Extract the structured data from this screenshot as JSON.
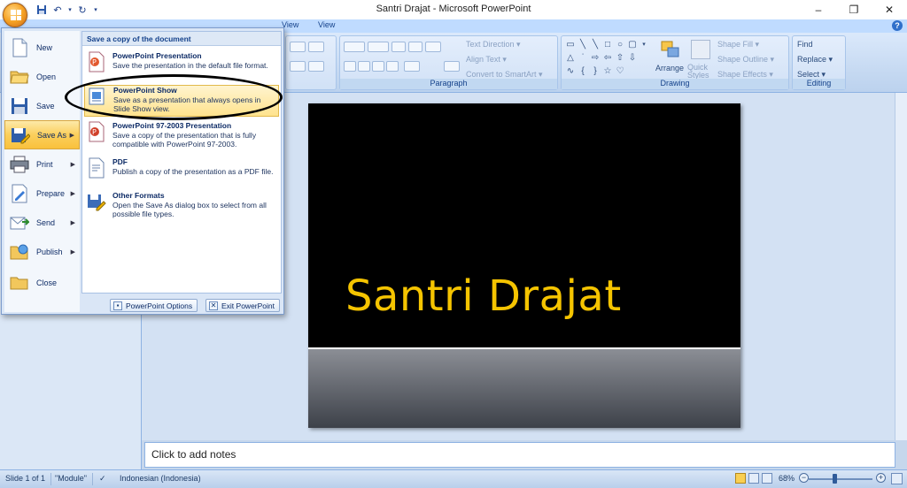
{
  "window": {
    "title": "Santri Drajat - Microsoft PowerPoint",
    "minimize_icon": "–",
    "restore_icon": "❐",
    "close_icon": "✕"
  },
  "quick_access": {
    "save_icon": "save-icon",
    "undo_icon": "undo-icon",
    "redo_icon": "repeat-icon"
  },
  "tabs": [
    {
      "label": "View"
    },
    {
      "label": "View"
    }
  ],
  "help": "?",
  "ribbon": {
    "paragraph_group_label": "Paragraph",
    "drawing_group_label": "Drawing",
    "editing_group_label": "Editing",
    "text_direction": "Text Direction ▾",
    "align_text": "Align Text ▾",
    "convert_smartart": "Convert to SmartArt ▾",
    "arrange": "Arrange",
    "quick_styles": "Quick Styles ▾",
    "shape_fill": "Shape Fill ▾",
    "shape_outline": "Shape Outline ▾",
    "shape_effects": "Shape Effects ▾",
    "find": "Find",
    "replace": "Replace ▾",
    "select": "Select ▾"
  },
  "office_menu": {
    "left_items": [
      {
        "label": "New",
        "icon": "new-document-icon",
        "has_submenu": false
      },
      {
        "label": "Open",
        "icon": "open-folder-icon",
        "has_submenu": false
      },
      {
        "label": "Save",
        "icon": "save-icon",
        "has_submenu": false
      },
      {
        "label": "Save As",
        "icon": "save-as-icon",
        "has_submenu": true
      },
      {
        "label": "Print",
        "icon": "print-icon",
        "has_submenu": true
      },
      {
        "label": "Prepare",
        "icon": "prepare-icon",
        "has_submenu": true
      },
      {
        "label": "Send",
        "icon": "send-icon",
        "has_submenu": true
      },
      {
        "label": "Publish",
        "icon": "publish-icon",
        "has_submenu": true
      },
      {
        "label": "Close",
        "icon": "close-folder-icon",
        "has_submenu": false
      }
    ],
    "active_item": "Save As",
    "submenu_header": "Save a copy of the document",
    "submenu_items": [
      {
        "title": "PowerPoint Presentation",
        "desc": "Save the presentation in the default file format.",
        "icon": "pptx-icon"
      },
      {
        "title": "PowerPoint Show",
        "desc": "Save as a presentation that always opens in Slide Show view.",
        "icon": "ppsx-icon"
      },
      {
        "title": "PowerPoint 97-2003 Presentation",
        "desc": "Save a copy of the presentation that is fully compatible with PowerPoint 97-2003.",
        "icon": "ppt-icon"
      },
      {
        "title": "PDF",
        "desc": "Publish a copy of the presentation as a PDF file.",
        "icon": "pdf-icon"
      },
      {
        "title": "Other Formats",
        "desc": "Open the Save As dialog box to select from all possible file types.",
        "icon": "other-formats-icon"
      }
    ],
    "options_button": "PowerPoint Options",
    "exit_button": "Exit PowerPoint"
  },
  "slide": {
    "title": "Santri Drajat"
  },
  "notes": {
    "placeholder": "Click to add notes"
  },
  "status": {
    "slide_info": "Slide 1 of 1",
    "theme": "\"Module\"",
    "language": "Indonesian (Indonesia)",
    "zoom": "68%"
  },
  "colors": {
    "slide_title": "#f5c400",
    "menu_highlight": "#fbcf5c",
    "office_button": "#f6a325"
  }
}
